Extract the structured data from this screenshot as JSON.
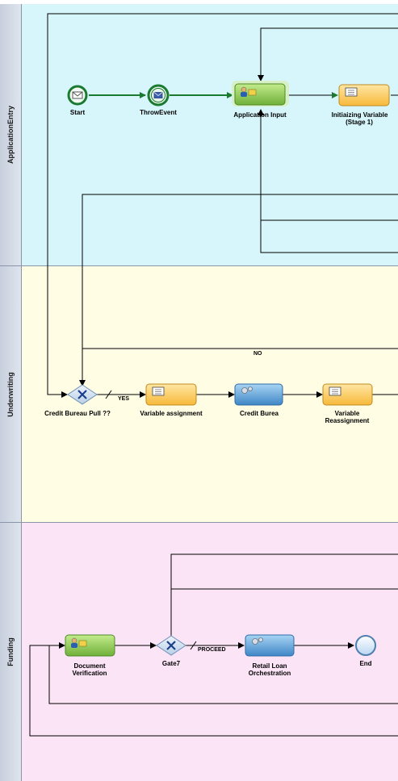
{
  "lanes": {
    "application_entry": "ApplicationEntry",
    "underwriting": "Underwriting",
    "funding": "Funding"
  },
  "nodes": {
    "start": "Start",
    "throw_event": "ThrowEvent",
    "application_input": "Application Input",
    "initializing_variables": "Initiaizing  Variable",
    "initializing_stage": "(Stage 1)",
    "credit_bureau_pull": "Credit Bureau Pull ??",
    "variable_assignment": "Variable assignment",
    "credit_bureau": "Credit Burea",
    "variable_reassignment_1": "Variable",
    "variable_reassignment_2": "Reassignment",
    "document_verification_1": "Document",
    "document_verification_2": "Verification",
    "gate7": "Gate7",
    "retail_loan_1": "Retail  Loan",
    "retail_loan_2": "Orchestration",
    "end": "End"
  },
  "flow_labels": {
    "yes": "YES",
    "no": "NO",
    "proceed": "PROCEED"
  },
  "colors": {
    "application_entry_lane": "#d6f6fb",
    "underwriting_lane": "#fffde4",
    "funding_lane": "#fbe4f6",
    "user_task": "#8fcc4f",
    "script_task": "#ffc74d",
    "service_task": "#5aa0d8",
    "event": "#1f8a3a"
  },
  "icons": {
    "start": "envelope-icon",
    "throw_event": "envelope-filled-icon",
    "user_task": "user-puzzle-icon",
    "script_task": "scroll-icon",
    "service_task": "gears-icon",
    "gateway": "x-gateway-icon"
  }
}
